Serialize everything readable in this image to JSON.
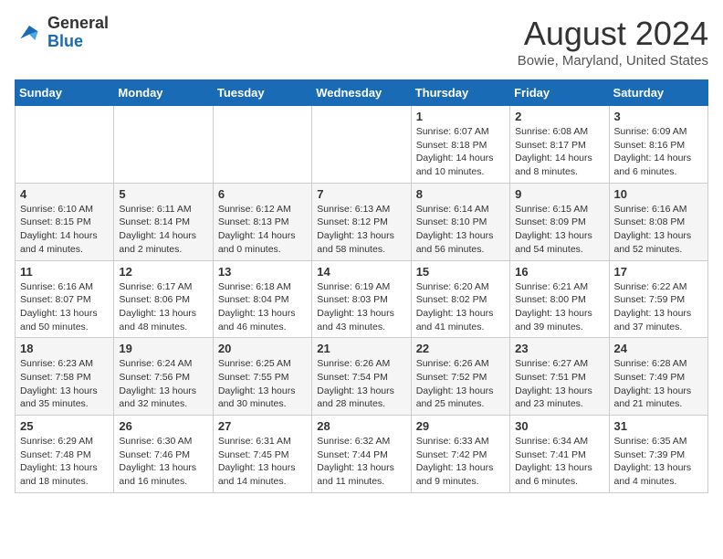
{
  "logo": {
    "general": "General",
    "blue": "Blue"
  },
  "header": {
    "month_year": "August 2024",
    "location": "Bowie, Maryland, United States"
  },
  "days_of_week": [
    "Sunday",
    "Monday",
    "Tuesday",
    "Wednesday",
    "Thursday",
    "Friday",
    "Saturday"
  ],
  "weeks": [
    [
      {
        "day": "",
        "info": ""
      },
      {
        "day": "",
        "info": ""
      },
      {
        "day": "",
        "info": ""
      },
      {
        "day": "",
        "info": ""
      },
      {
        "day": "1",
        "info": "Sunrise: 6:07 AM\nSunset: 8:18 PM\nDaylight: 14 hours and 10 minutes."
      },
      {
        "day": "2",
        "info": "Sunrise: 6:08 AM\nSunset: 8:17 PM\nDaylight: 14 hours and 8 minutes."
      },
      {
        "day": "3",
        "info": "Sunrise: 6:09 AM\nSunset: 8:16 PM\nDaylight: 14 hours and 6 minutes."
      }
    ],
    [
      {
        "day": "4",
        "info": "Sunrise: 6:10 AM\nSunset: 8:15 PM\nDaylight: 14 hours and 4 minutes."
      },
      {
        "day": "5",
        "info": "Sunrise: 6:11 AM\nSunset: 8:14 PM\nDaylight: 14 hours and 2 minutes."
      },
      {
        "day": "6",
        "info": "Sunrise: 6:12 AM\nSunset: 8:13 PM\nDaylight: 14 hours and 0 minutes."
      },
      {
        "day": "7",
        "info": "Sunrise: 6:13 AM\nSunset: 8:12 PM\nDaylight: 13 hours and 58 minutes."
      },
      {
        "day": "8",
        "info": "Sunrise: 6:14 AM\nSunset: 8:10 PM\nDaylight: 13 hours and 56 minutes."
      },
      {
        "day": "9",
        "info": "Sunrise: 6:15 AM\nSunset: 8:09 PM\nDaylight: 13 hours and 54 minutes."
      },
      {
        "day": "10",
        "info": "Sunrise: 6:16 AM\nSunset: 8:08 PM\nDaylight: 13 hours and 52 minutes."
      }
    ],
    [
      {
        "day": "11",
        "info": "Sunrise: 6:16 AM\nSunset: 8:07 PM\nDaylight: 13 hours and 50 minutes."
      },
      {
        "day": "12",
        "info": "Sunrise: 6:17 AM\nSunset: 8:06 PM\nDaylight: 13 hours and 48 minutes."
      },
      {
        "day": "13",
        "info": "Sunrise: 6:18 AM\nSunset: 8:04 PM\nDaylight: 13 hours and 46 minutes."
      },
      {
        "day": "14",
        "info": "Sunrise: 6:19 AM\nSunset: 8:03 PM\nDaylight: 13 hours and 43 minutes."
      },
      {
        "day": "15",
        "info": "Sunrise: 6:20 AM\nSunset: 8:02 PM\nDaylight: 13 hours and 41 minutes."
      },
      {
        "day": "16",
        "info": "Sunrise: 6:21 AM\nSunset: 8:00 PM\nDaylight: 13 hours and 39 minutes."
      },
      {
        "day": "17",
        "info": "Sunrise: 6:22 AM\nSunset: 7:59 PM\nDaylight: 13 hours and 37 minutes."
      }
    ],
    [
      {
        "day": "18",
        "info": "Sunrise: 6:23 AM\nSunset: 7:58 PM\nDaylight: 13 hours and 35 minutes."
      },
      {
        "day": "19",
        "info": "Sunrise: 6:24 AM\nSunset: 7:56 PM\nDaylight: 13 hours and 32 minutes."
      },
      {
        "day": "20",
        "info": "Sunrise: 6:25 AM\nSunset: 7:55 PM\nDaylight: 13 hours and 30 minutes."
      },
      {
        "day": "21",
        "info": "Sunrise: 6:26 AM\nSunset: 7:54 PM\nDaylight: 13 hours and 28 minutes."
      },
      {
        "day": "22",
        "info": "Sunrise: 6:26 AM\nSunset: 7:52 PM\nDaylight: 13 hours and 25 minutes."
      },
      {
        "day": "23",
        "info": "Sunrise: 6:27 AM\nSunset: 7:51 PM\nDaylight: 13 hours and 23 minutes."
      },
      {
        "day": "24",
        "info": "Sunrise: 6:28 AM\nSunset: 7:49 PM\nDaylight: 13 hours and 21 minutes."
      }
    ],
    [
      {
        "day": "25",
        "info": "Sunrise: 6:29 AM\nSunset: 7:48 PM\nDaylight: 13 hours and 18 minutes."
      },
      {
        "day": "26",
        "info": "Sunrise: 6:30 AM\nSunset: 7:46 PM\nDaylight: 13 hours and 16 minutes."
      },
      {
        "day": "27",
        "info": "Sunrise: 6:31 AM\nSunset: 7:45 PM\nDaylight: 13 hours and 14 minutes."
      },
      {
        "day": "28",
        "info": "Sunrise: 6:32 AM\nSunset: 7:44 PM\nDaylight: 13 hours and 11 minutes."
      },
      {
        "day": "29",
        "info": "Sunrise: 6:33 AM\nSunset: 7:42 PM\nDaylight: 13 hours and 9 minutes."
      },
      {
        "day": "30",
        "info": "Sunrise: 6:34 AM\nSunset: 7:41 PM\nDaylight: 13 hours and 6 minutes."
      },
      {
        "day": "31",
        "info": "Sunrise: 6:35 AM\nSunset: 7:39 PM\nDaylight: 13 hours and 4 minutes."
      }
    ]
  ]
}
